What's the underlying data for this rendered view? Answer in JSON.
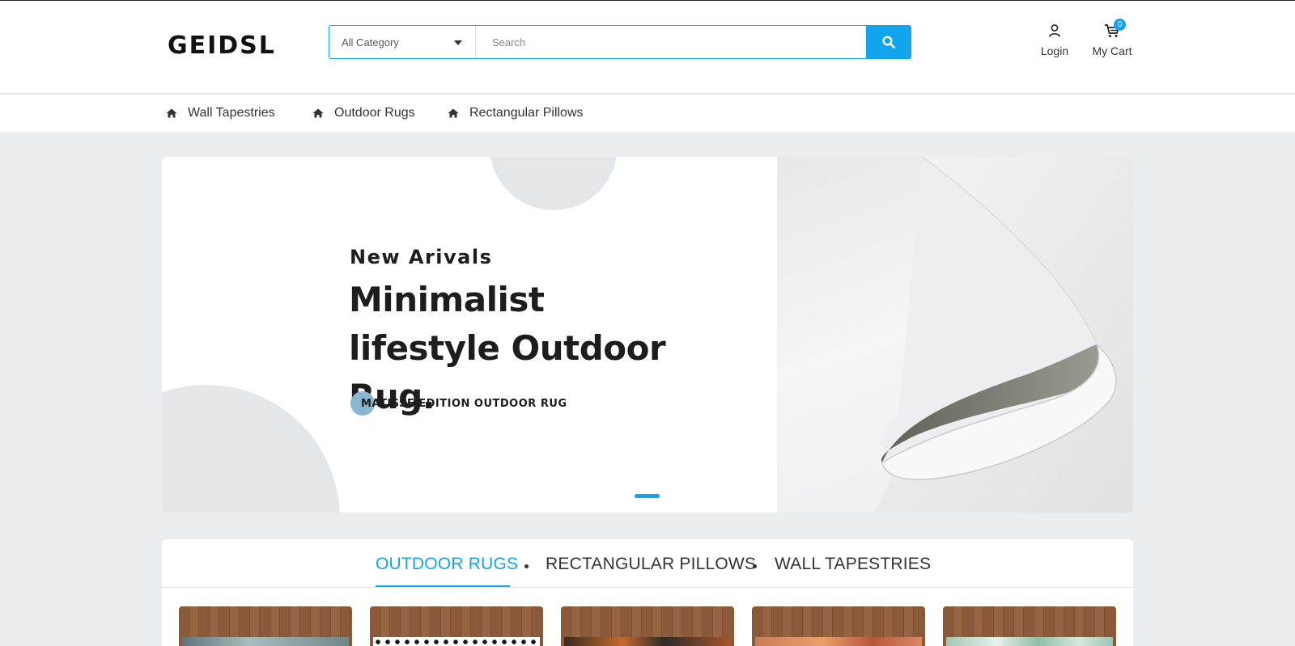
{
  "header": {
    "logo": "GEIDSL",
    "category_select": "All Category",
    "search_placeholder": "Search",
    "login_label": "Login",
    "cart_label": "My Cart",
    "cart_count": "0"
  },
  "nav": {
    "items": [
      {
        "label": "Wall Tapestries",
        "icon": "home-icon"
      },
      {
        "label": "Outdoor Rugs",
        "icon": "home-icon"
      },
      {
        "label": "Rectangular Pillows",
        "icon": "home-icon"
      }
    ]
  },
  "hero": {
    "subtitle": "New Arivals",
    "title": "Minimalist lifestyle Outdoor Rug.",
    "cta": "MATISSE EDITION OUTDOOR RUG",
    "slide_count": 1,
    "active_slide": 1
  },
  "tabs": {
    "items": [
      "OUTDOOR RUGS",
      "RECTANGULAR PILLOWS",
      "WALL TAPESTRIES"
    ],
    "active": "OUTDOOR RUGS"
  },
  "products": {
    "count_visible": 5
  },
  "colors": {
    "accent": "#12a5ee",
    "background": "#ebeef0",
    "text": "#222222"
  }
}
